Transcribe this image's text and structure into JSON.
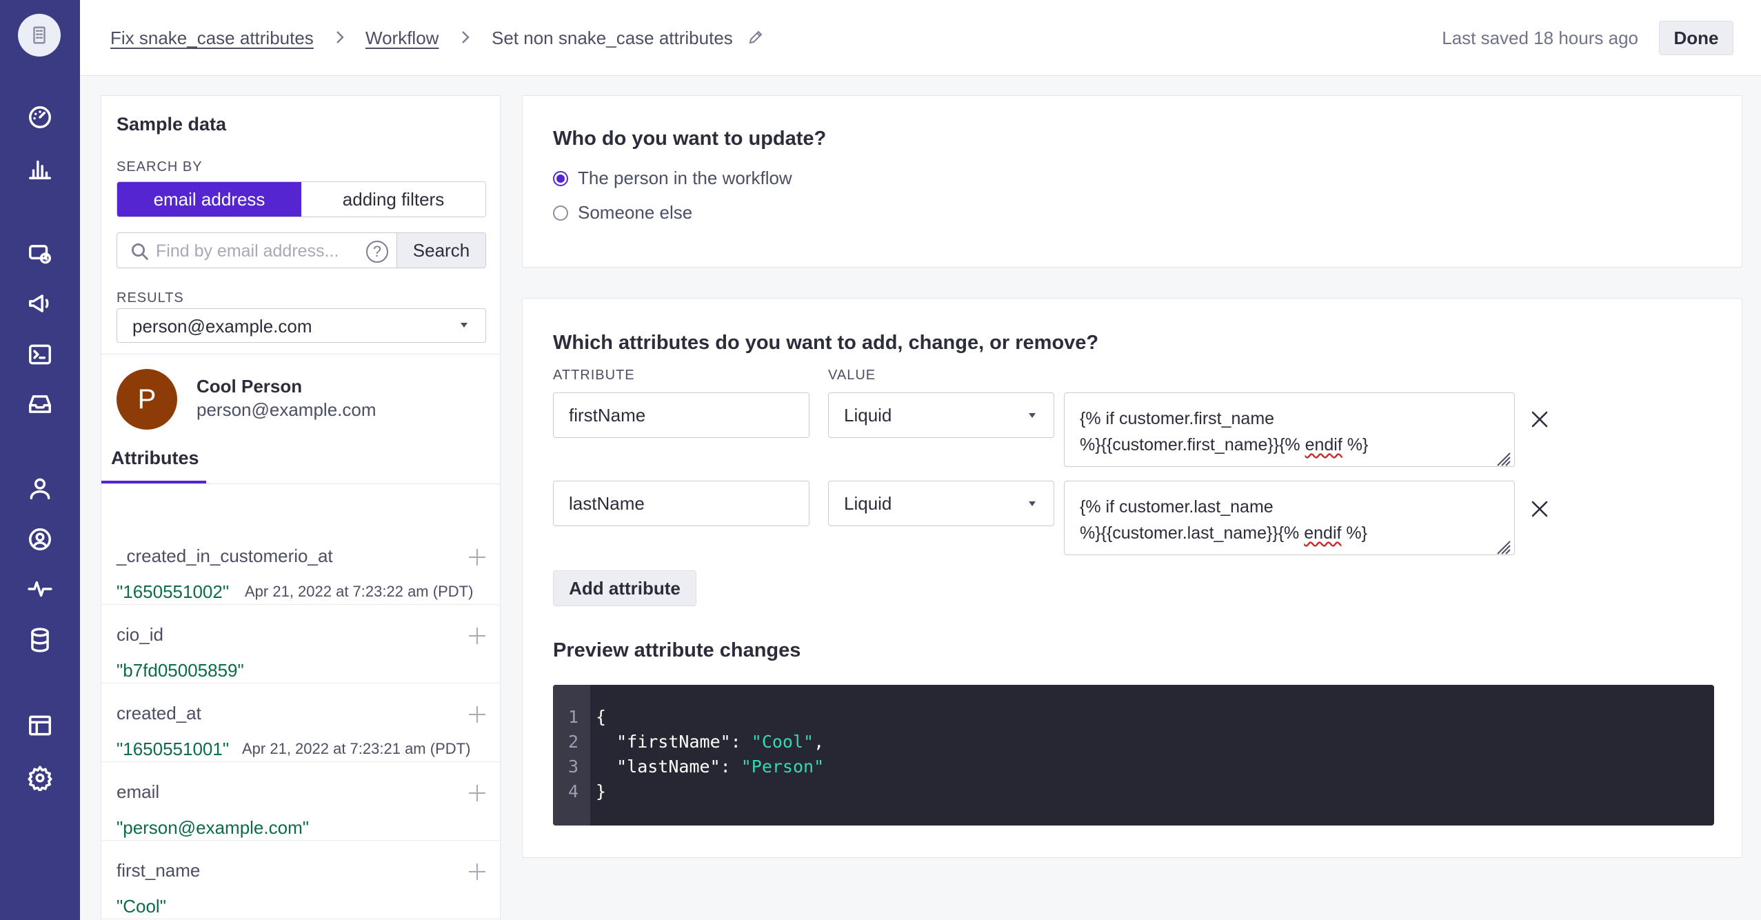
{
  "nav": {
    "logo_icon": "building-icon",
    "icons": [
      "dashboard-icon",
      "analytics-icon",
      "campaigns-icon",
      "broadcasts-icon",
      "transactional-icon",
      "inbox-icon",
      "people-icon",
      "segments-icon",
      "activity-icon",
      "data-icon",
      "objects-icon",
      "settings-icon"
    ]
  },
  "header": {
    "breadcrumb": [
      "Fix snake_case attributes",
      "Workflow",
      "Set non snake_case attributes"
    ],
    "saved_text": "Last saved 18 hours ago",
    "done_label": "Done"
  },
  "sample": {
    "title": "Sample data",
    "search_by_label": "SEARCH BY",
    "seg_email": "email address",
    "seg_filters": "adding filters",
    "search_placeholder": "Find by email address...",
    "help_glyph": "?",
    "search_button": "Search",
    "results_label": "RESULTS",
    "results_value": "person@example.com",
    "person": {
      "initial": "P",
      "name": "Cool Person",
      "email": "person@example.com"
    },
    "attributes_tab": "Attributes",
    "attributes": [
      {
        "name": "_created_in_customerio_at",
        "value": "\"1650551002\"",
        "date": "Apr 21, 2022 at 7:23:22 am (PDT)"
      },
      {
        "name": "cio_id",
        "value": "\"b7fd05005859\"",
        "date": ""
      },
      {
        "name": "created_at",
        "value": "\"1650551001\"",
        "date": "Apr 21, 2022 at 7:23:21 am (PDT)"
      },
      {
        "name": "email",
        "value": "\"person@example.com\"",
        "date": ""
      },
      {
        "name": "first_name",
        "value": "\"Cool\"",
        "date": ""
      }
    ]
  },
  "update_card": {
    "title": "Who do you want to update?",
    "option1": "The person in the workflow",
    "option2": "Someone else",
    "selected": "option1"
  },
  "attrs_card": {
    "title": "Which attributes do you want to add, change, or remove?",
    "col_attribute": "ATTRIBUTE",
    "col_value": "VALUE",
    "rows": [
      {
        "attribute": "firstName",
        "type": "Liquid",
        "value_line1": "{% if customer.first_name",
        "value_line2_a": "%}{{customer.first_name}}{% ",
        "value_line2_b": "endif",
        "value_line2_c": " %}"
      },
      {
        "attribute": "lastName",
        "type": "Liquid",
        "value_line1": "{% if customer.last_name",
        "value_line2_a": "%}{{customer.last_name}}{% ",
        "value_line2_b": "endif",
        "value_line2_c": " %}"
      }
    ],
    "add_button": "Add attribute",
    "preview_title": "Preview attribute changes",
    "preview": {
      "line_numbers": [
        "1",
        "2",
        "3",
        "4"
      ],
      "open": "{",
      "k1": "  \"firstName\": ",
      "v1": "\"Cool\"",
      "comma": ",",
      "k2": "  \"lastName\": ",
      "v2": "\"Person\"",
      "close": "}"
    }
  },
  "colors": {
    "rail": "#3b3b83",
    "accent": "#5425d1",
    "value_green": "#0b6b4a",
    "code_bg": "#272733",
    "code_string": "#35d9b0",
    "avatar": "#8e3c07"
  }
}
